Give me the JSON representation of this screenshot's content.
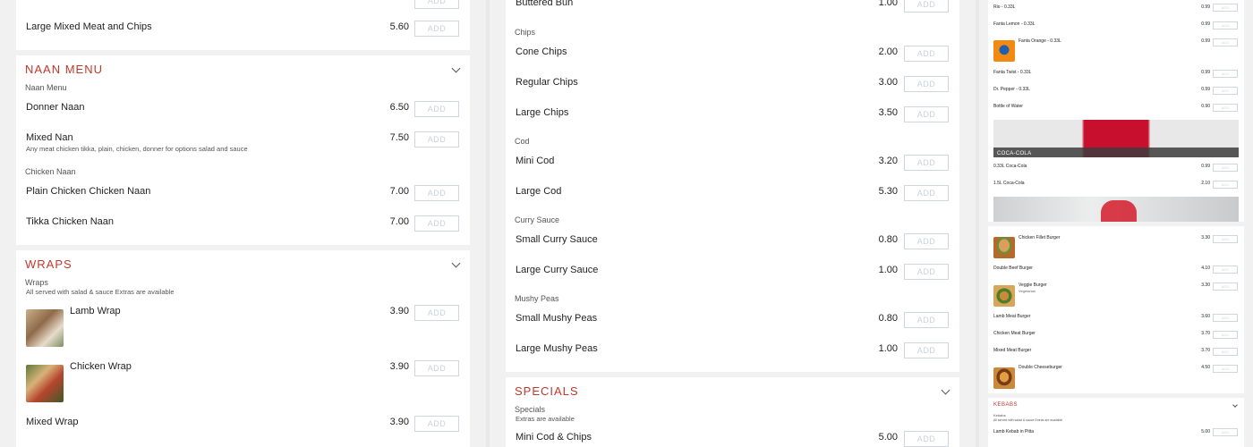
{
  "col1": {
    "top_item": {
      "name": "Large Mixed Meat and Chips",
      "price": "5.60"
    },
    "naan": {
      "title": "NAAN MENU",
      "sub1": "Naan Menu",
      "donner": {
        "name": "Donner Naan",
        "price": "6.50"
      },
      "mixed": {
        "name": "Mixed Nan",
        "desc": "Any meat chicken tikka, plain, chicken, donner for options salad and sauce",
        "price": "7.50"
      },
      "sub2": "Chicken Naan",
      "plain": {
        "name": "Plain Chicken Chicken Naan",
        "price": "7.00"
      },
      "tikka": {
        "name": "Tikka Chicken Naan",
        "price": "7.00"
      }
    },
    "wraps": {
      "title": "WRAPS",
      "sub": "Wraps",
      "desc": "All served with salad & sauce Extras are available",
      "lamb": {
        "name": "Lamb Wrap",
        "price": "3.90"
      },
      "chicken": {
        "name": "Chicken Wrap",
        "price": "3.90"
      },
      "mixed": {
        "name": "Mixed Wrap",
        "price": "3.90"
      }
    }
  },
  "col2": {
    "buttered": {
      "name": "Buttered Bun",
      "price": "1.00"
    },
    "chips_sub": "Chips",
    "cone": {
      "name": "Cone Chips",
      "price": "2.00"
    },
    "regular": {
      "name": "Regular Chips",
      "price": "3.00"
    },
    "large": {
      "name": "Large Chips",
      "price": "3.50"
    },
    "cod_sub": "Cod",
    "mini_cod": {
      "name": "Mini Cod",
      "price": "3.20"
    },
    "large_cod": {
      "name": "Large Cod",
      "price": "5.30"
    },
    "curry_sub": "Curry Sauce",
    "small_curry": {
      "name": "Small Curry Sauce",
      "price": "0.80"
    },
    "large_curry": {
      "name": "Large Curry Sauce",
      "price": "1.00"
    },
    "peas_sub": "Mushy Peas",
    "small_peas": {
      "name": "Small Mushy Peas",
      "price": "0.80"
    },
    "large_peas": {
      "name": "Large Mushy Peas",
      "price": "1.00"
    },
    "specials": {
      "title": "SPECIALS",
      "sub": "Specials",
      "desc": "Extras are available",
      "mini_cod_chips": {
        "name": "Mini Cod & Chips",
        "price": "5.00"
      }
    }
  },
  "col3": {
    "rio": {
      "name": "Rio - 0.33L",
      "price": "0.99"
    },
    "fanta_lemon": {
      "name": "Fanta Lemon - 0.33L",
      "price": "0.99"
    },
    "fanta_orange": {
      "name": "Fanta Orange - 0.33L",
      "price": "0.99"
    },
    "fanta_twist": {
      "name": "Fanta Twist - 0.33L",
      "price": "0.99"
    },
    "dr_pepper": {
      "name": "Dr. Pepper - 0.33L",
      "price": "0.99"
    },
    "water": {
      "name": "Bottle of Water",
      "price": "0.90"
    },
    "coca_banner": "COCA-COLA",
    "coke033": {
      "name": "0.33L Coca-Cola",
      "price": "0.99"
    },
    "coke15": {
      "name": "1.5L Coca-Cola",
      "price": "2.10"
    },
    "chicken_fillet": {
      "name": "Chicken Fillet Burger",
      "price": "3.30"
    },
    "double_beef": {
      "name": "Double Beef Burger",
      "price": "4.10"
    },
    "veggie": {
      "name": "Veggie Burger",
      "tag": "Vegetarian",
      "price": "3.30"
    },
    "lamb_meat": {
      "name": "Lamb Meat Burger",
      "price": "3.60"
    },
    "chicken_meat": {
      "name": "Chicken Meat Burger",
      "price": "3.70"
    },
    "mixed_meat": {
      "name": "Mixed Meat Burger",
      "price": "3.70"
    },
    "double_cheese": {
      "name": "Double Cheeseburger",
      "price": "4.50"
    },
    "kebabs": {
      "title": "KEBABS",
      "sub": "Kebabs",
      "desc": "All served with salad & sauce Extras are available",
      "lamb_pitta": {
        "name": "Lamb Kebab in Pitta",
        "price": "5.00"
      }
    }
  },
  "add_label": "ADD",
  "colors": {
    "accent": "#c0392b",
    "button_border": "#cfd6df"
  }
}
